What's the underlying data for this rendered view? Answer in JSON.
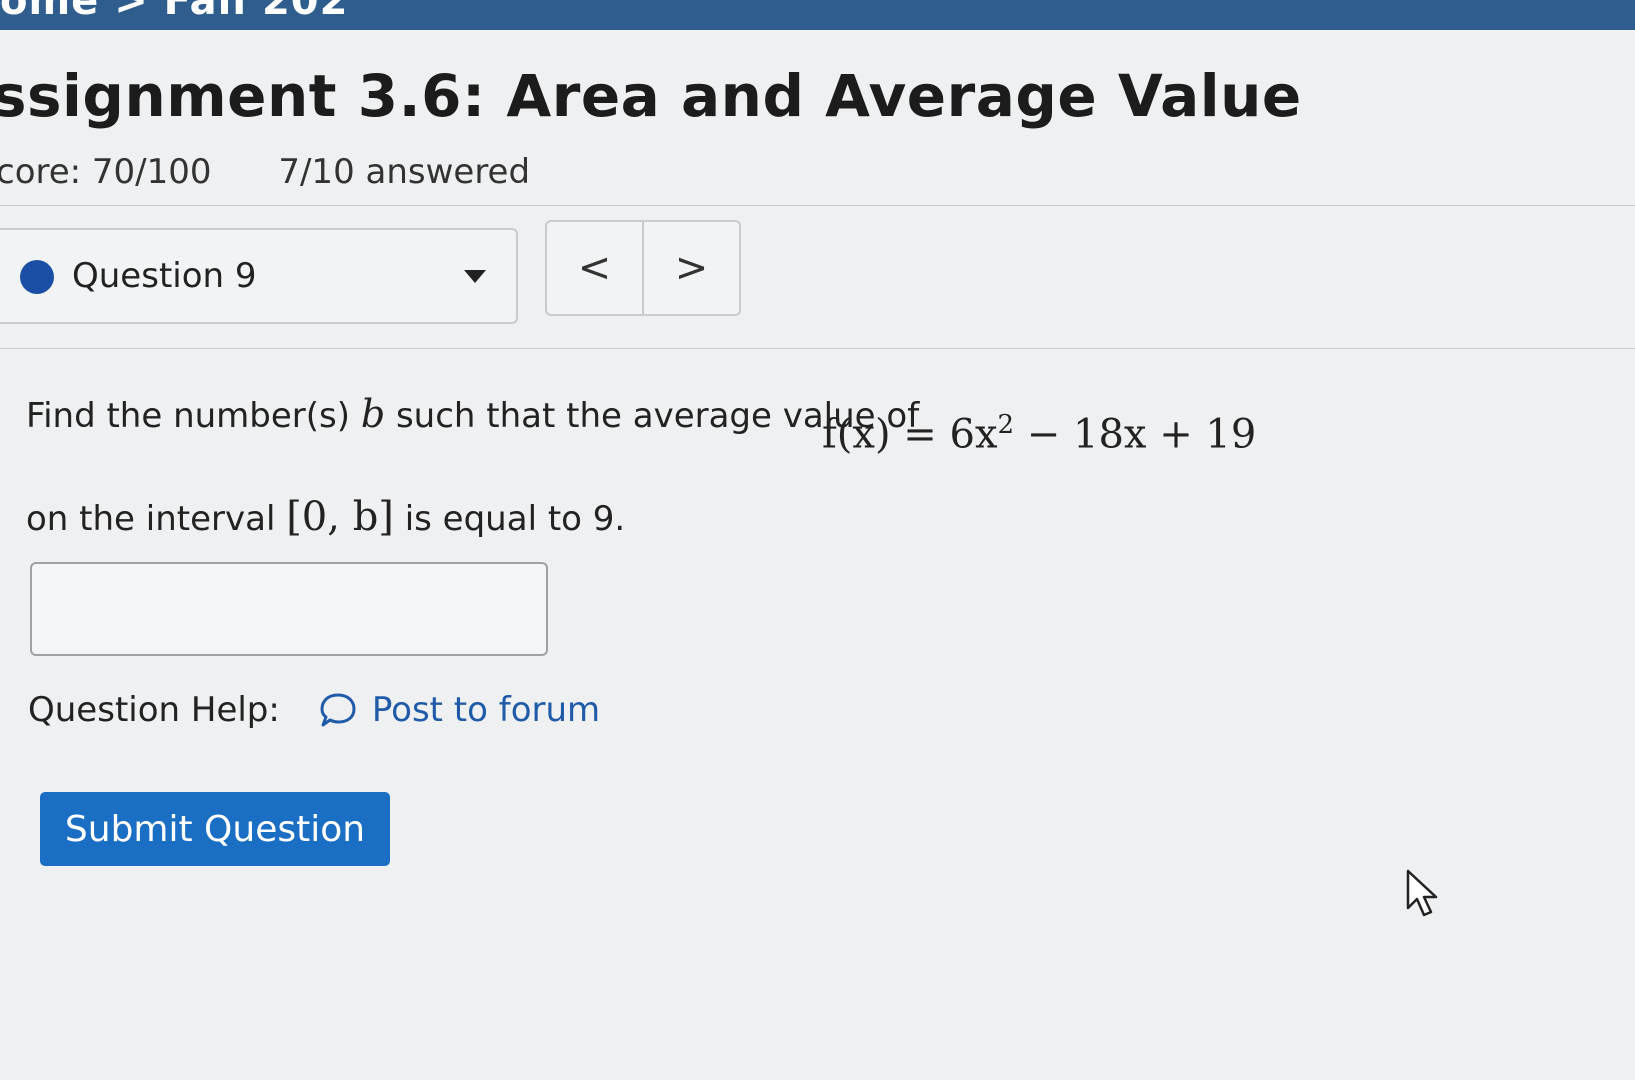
{
  "breadcrumb": "ome > Fall 202",
  "title": "ssignment 3.6: Area and Average Value",
  "score": {
    "score_text": "core: 70/100",
    "answered_text": "7/10 answered"
  },
  "question_nav": {
    "selected_label": "Question 9",
    "prev_glyph": "<",
    "next_glyph": ">"
  },
  "question": {
    "prompt_before": "Find the number(s) ",
    "var_b": "b",
    "prompt_after": " such that the average value of",
    "formula_lhs": "f(x) = 6x",
    "formula_exp": "2",
    "formula_rhs": " − 18x + 19",
    "interval_before": "on the interval ",
    "interval_math": "[0, b]",
    "interval_after": " is equal to 9."
  },
  "answer": {
    "value": "",
    "placeholder": ""
  },
  "help": {
    "label": "Question Help:",
    "forum_link": "Post to forum"
  },
  "submit_label": "Submit Question",
  "colors": {
    "primary_button": "#1a6fc4",
    "link": "#1f5ba8",
    "status_dot": "#1b4fa5",
    "top_bar": "#2e5d8e"
  },
  "icons": {
    "status": "status-dot-icon",
    "dropdown": "caret-down-icon",
    "forum": "chat-bubble-icon",
    "pointer": "mouse-pointer-icon"
  }
}
